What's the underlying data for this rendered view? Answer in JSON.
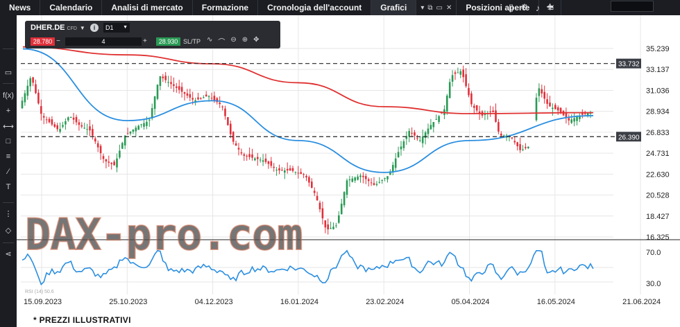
{
  "nav": {
    "tabs": [
      "News",
      "Calendario",
      "Analisi di mercato",
      "Formazione",
      "Cronologia dell'account",
      "Grafici",
      "Posizioni aperte"
    ],
    "active_tab": "Grafici"
  },
  "panel": {
    "symbol": "DHER.DE",
    "instrument_type": "CFD",
    "timeframe": "D1",
    "sell_price": "28.780",
    "buy_price": "28.930",
    "quantity": "4",
    "sltp_label": "SL/TP"
  },
  "watermark": "DAX-pro.com",
  "footer_note": "* PREZZI ILLUSTRATIVI",
  "chart_data": {
    "type": "line",
    "x_ticks": [
      "15.09.2023",
      "25.10.2023",
      "04.12.2023",
      "16.01.2024",
      "23.02.2024",
      "05.04.2024",
      "16.05.2024",
      "21.06.2024"
    ],
    "y_ticks": [
      "35.239",
      "33.137",
      "31.036",
      "28.934",
      "26.833",
      "24.731",
      "22.630",
      "20.528",
      "18.427",
      "16.325"
    ],
    "ylim": [
      16.325,
      35.239
    ],
    "horizontal_levels": [
      {
        "value": 33.732,
        "label": "33.732",
        "style": "dashed"
      },
      {
        "value": 26.39,
        "label": "26.390",
        "style": "dashed"
      }
    ],
    "series": [
      {
        "name": "",
        "color": "#e03030",
        "x": [
          "15.09.2023",
          "25.10.2023",
          "04.12.2023",
          "16.01.2024",
          "23.02.2024",
          "05.04.2024",
          "16.05.2024"
        ],
        "values": [
          35.4,
          34.6,
          33.7,
          31.8,
          29.4,
          28.7,
          28.8
        ]
      },
      {
        "name": "",
        "color": "#2a8ee0",
        "x": [
          "15.09.2023",
          "25.10.2023",
          "04.12.2023",
          "16.01.2024",
          "23.02.2024",
          "05.04.2024",
          "16.05.2024"
        ],
        "values": [
          35.2,
          28.0,
          30.0,
          26.0,
          22.8,
          26.0,
          28.5
        ]
      }
    ],
    "indicator": {
      "label": "RSI (14)",
      "value": "50.6",
      "y_ticks": [
        "70.0",
        "30.0"
      ],
      "color": "#2a8ee0"
    },
    "colors": {
      "up": "#2a9a55",
      "down": "#e0303a",
      "ma_long": "#e03030",
      "ma_short": "#2a8ee0"
    }
  }
}
